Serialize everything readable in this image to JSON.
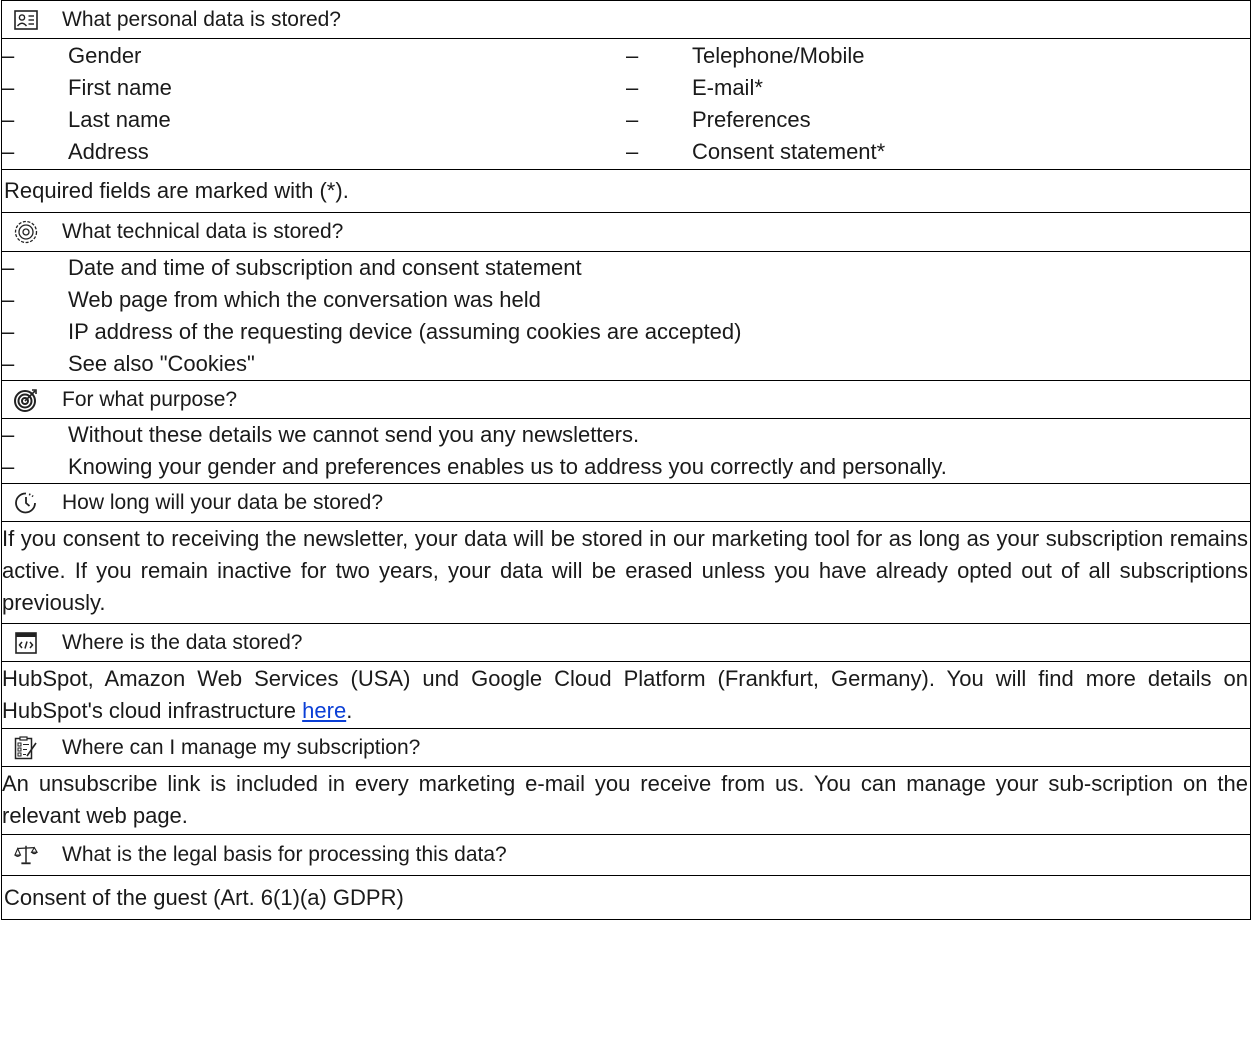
{
  "sections": {
    "personal": {
      "title": "What personal data is stored?",
      "icon": "contact-card-icon",
      "left_items": [
        "Gender",
        "First name",
        "Last name",
        "Address"
      ],
      "right_items": [
        "Telephone/Mobile",
        "E-mail*",
        "Preferences",
        "Consent statement*"
      ],
      "note": "Required fields are marked with (*)."
    },
    "technical": {
      "title": "What technical data is stored?",
      "icon": "gear-icon",
      "items": [
        "Date and time of subscription and consent statement",
        "Web page from which the conversation was held",
        "IP address of the requesting device (assuming cookies are accepted)",
        "See also \"Cookies\""
      ]
    },
    "purpose": {
      "title": "For what purpose?",
      "icon": "target-icon",
      "items": [
        "Without these details we cannot send you any newsletters.",
        "Knowing your gender and preferences enables us to address you correctly and personally."
      ]
    },
    "duration": {
      "title": "How long will your data be stored?",
      "icon": "clock-icon",
      "text": "If you consent to receiving the newsletter, your data will be stored in our marketing tool for as long as your subscription remains active. If you remain inactive for two years, your data will be erased unless you have already opted out of all subscriptions previously."
    },
    "location": {
      "title": "Where is the data stored?",
      "icon": "code-window-icon",
      "text": "HubSpot, Amazon Web Services (USA) und Google Cloud Platform (Frankfurt, Germany). You will find more details on HubSpot's cloud infrastructure ",
      "link": "here",
      "text_end": "."
    },
    "manage": {
      "title": "Where can I manage my subscription?",
      "icon": "checklist-icon",
      "text": "An unsubscribe link is included in every marketing e-mail you receive from us. You can manage your sub-scription on the relevant web page."
    },
    "legal": {
      "title": "What is the legal basis for processing this data?",
      "icon": "scales-icon",
      "text": "Consent of the guest (Art. 6(1)(a) GDPR)"
    }
  },
  "colors": {
    "link": "#0b3fd6",
    "border": "#000000"
  }
}
